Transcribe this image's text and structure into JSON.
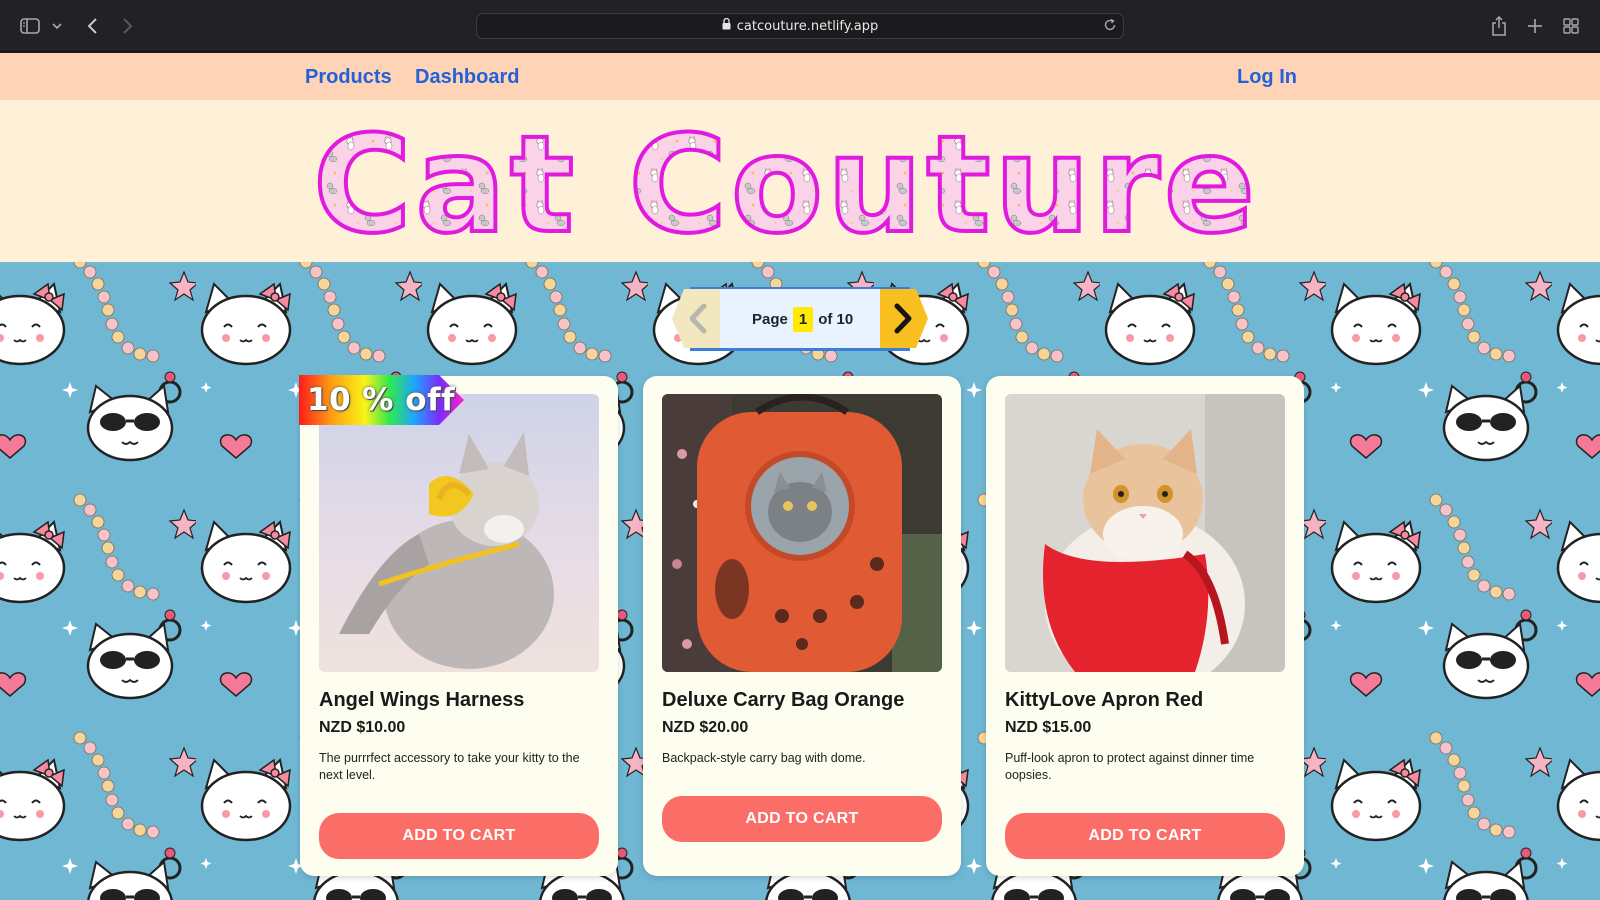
{
  "browser": {
    "url": "catcouture.netlify.app",
    "icons": [
      "sidebar-icon",
      "chevron-down-icon",
      "back-arrow-icon",
      "forward-arrow-icon",
      "lock-icon",
      "reload-icon",
      "share-icon",
      "new-tab-icon",
      "tab-overview-icon"
    ]
  },
  "nav": {
    "products": "Products",
    "dashboard": "Dashboard",
    "login": "Log In",
    "color": "#2262d8",
    "background": "#ffd4b6"
  },
  "header": {
    "logo_text": "Cat Couture",
    "background": "#fff0d8"
  },
  "pagination": {
    "prefix": "Page",
    "current": "1",
    "suffix": "of 10",
    "total": 10
  },
  "products": [
    {
      "name": "Angel Wings Harness",
      "price": "NZD $10.00",
      "description": "The purrrfect accessory to take your kitty to the next level.",
      "button": "ADD TO CART",
      "badge": "10 % off"
    },
    {
      "name": "Deluxe Carry Bag Orange",
      "price": "NZD $20.00",
      "description": "Backpack-style carry bag with dome.",
      "button": "ADD TO CART"
    },
    {
      "name": "KittyLove Apron Red",
      "price": "NZD $15.00",
      "description": "Puff-look apron to protect against dinner time oopsies.",
      "button": "ADD TO CART"
    }
  ],
  "colors": {
    "pattern_bg": "#6fb7d3",
    "card_bg": "#fdfdf0",
    "cart_button": "#fb6e68",
    "logo_outline": "#e11adf",
    "logo_fill": "#fbd3e8"
  }
}
